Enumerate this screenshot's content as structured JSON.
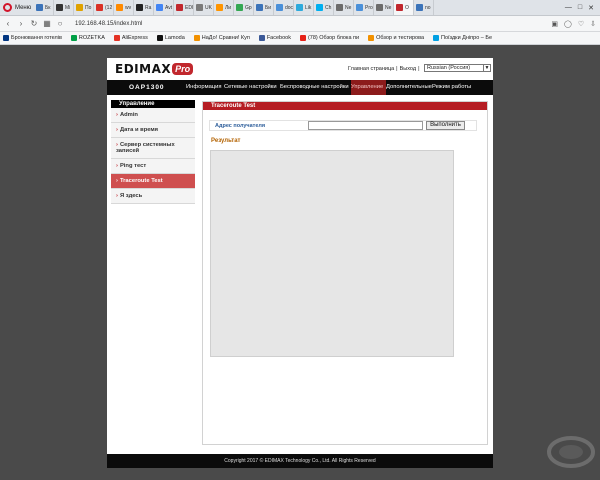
{
  "browser": {
    "menu_label": "Меню",
    "tabs": [
      {
        "label": "Бк",
        "color": "#3b73b9",
        "active": false
      },
      {
        "label": "Mi",
        "color": "#333333",
        "active": false
      },
      {
        "label": "По",
        "color": "#e0a200",
        "active": false
      },
      {
        "label": "(12",
        "color": "#d93025",
        "active": false
      },
      {
        "label": "wv",
        "color": "#ff8a00",
        "active": false
      },
      {
        "label": "Ra",
        "color": "#222222",
        "active": false
      },
      {
        "label": "Avt",
        "color": "#4285f4",
        "active": false
      },
      {
        "label": "EDI",
        "color": "#c1272d",
        "active": false
      },
      {
        "label": "UK",
        "color": "#7a7a7a",
        "active": false
      },
      {
        "label": "Ли",
        "color": "#ff9500",
        "active": false
      },
      {
        "label": "Gp",
        "color": "#34a853",
        "active": false
      },
      {
        "label": "Би",
        "color": "#3b73b9",
        "active": false
      },
      {
        "label": "doc",
        "color": "#4a90d9",
        "active": false
      },
      {
        "label": "Lik",
        "color": "#2eaadc",
        "active": false
      },
      {
        "label": "Ch",
        "color": "#00aff0",
        "active": false
      },
      {
        "label": "Ne",
        "color": "#6c6c6c",
        "active": false
      },
      {
        "label": "Pro",
        "color": "#4a90d9",
        "active": false
      },
      {
        "label": "Ne",
        "color": "#6c6c6c",
        "active": false
      },
      {
        "label": "О",
        "color": "#c1272d",
        "active": true
      },
      {
        "label": "no",
        "color": "#3b73b9",
        "active": false
      }
    ],
    "url": "192.168.48.15/index.html",
    "bookmarks": [
      {
        "label": "Бронювання готелів",
        "color": "#003580"
      },
      {
        "label": "ROZETKA",
        "color": "#00a046"
      },
      {
        "label": "AliExpress",
        "color": "#e43225"
      },
      {
        "label": "Lamoda",
        "color": "#111111"
      },
      {
        "label": "НаДо! Сравни! Куп",
        "color": "#f29100"
      },
      {
        "label": "Facebook",
        "color": "#3b5998"
      },
      {
        "label": "(78) Обзор блока пи",
        "color": "#e62117"
      },
      {
        "label": "Обзор и тестирова",
        "color": "#f29100"
      },
      {
        "label": "Поїздки Дніпро – Бе",
        "color": "#00a0e3"
      }
    ]
  },
  "page": {
    "logo_main": "EDIMAX",
    "logo_pro": "Pro",
    "top_links": {
      "home": "Главная страница",
      "separator": "|",
      "logout": "Выход",
      "separator2": "|"
    },
    "language": "Russian (Россия)",
    "model": "OAP1300",
    "menu": [
      {
        "label": "Информация",
        "width": 38,
        "active": false
      },
      {
        "label": "Сетевые настройки",
        "width": 56,
        "active": false
      },
      {
        "label": "Беспроводные настройки",
        "width": 71,
        "active": false
      },
      {
        "label": "Управление",
        "width": 35,
        "active": true
      },
      {
        "label": "Дополнительные",
        "width": 46,
        "active": false
      },
      {
        "label": "Режим работы",
        "width": 43,
        "active": false
      }
    ],
    "sidebar": {
      "title": "Управление",
      "items": [
        {
          "label": "Admin",
          "active": false
        },
        {
          "label": "Дата и время",
          "active": false
        },
        {
          "label": "Сервер системных записей",
          "active": false
        },
        {
          "label": "Ping тест",
          "active": false
        },
        {
          "label": "Traceroute Test",
          "active": true
        },
        {
          "label": "Я здесь",
          "active": false
        }
      ]
    },
    "content": {
      "title": "Traceroute Test",
      "dest_label": "Адрес получателя",
      "dest_value": "",
      "run_button": "Выполнить",
      "result_label": "Результат",
      "result_text": ""
    },
    "footer": "Copyright 2017 © EDIMAX Technology Co., Ltd. All Rights Reserved"
  }
}
